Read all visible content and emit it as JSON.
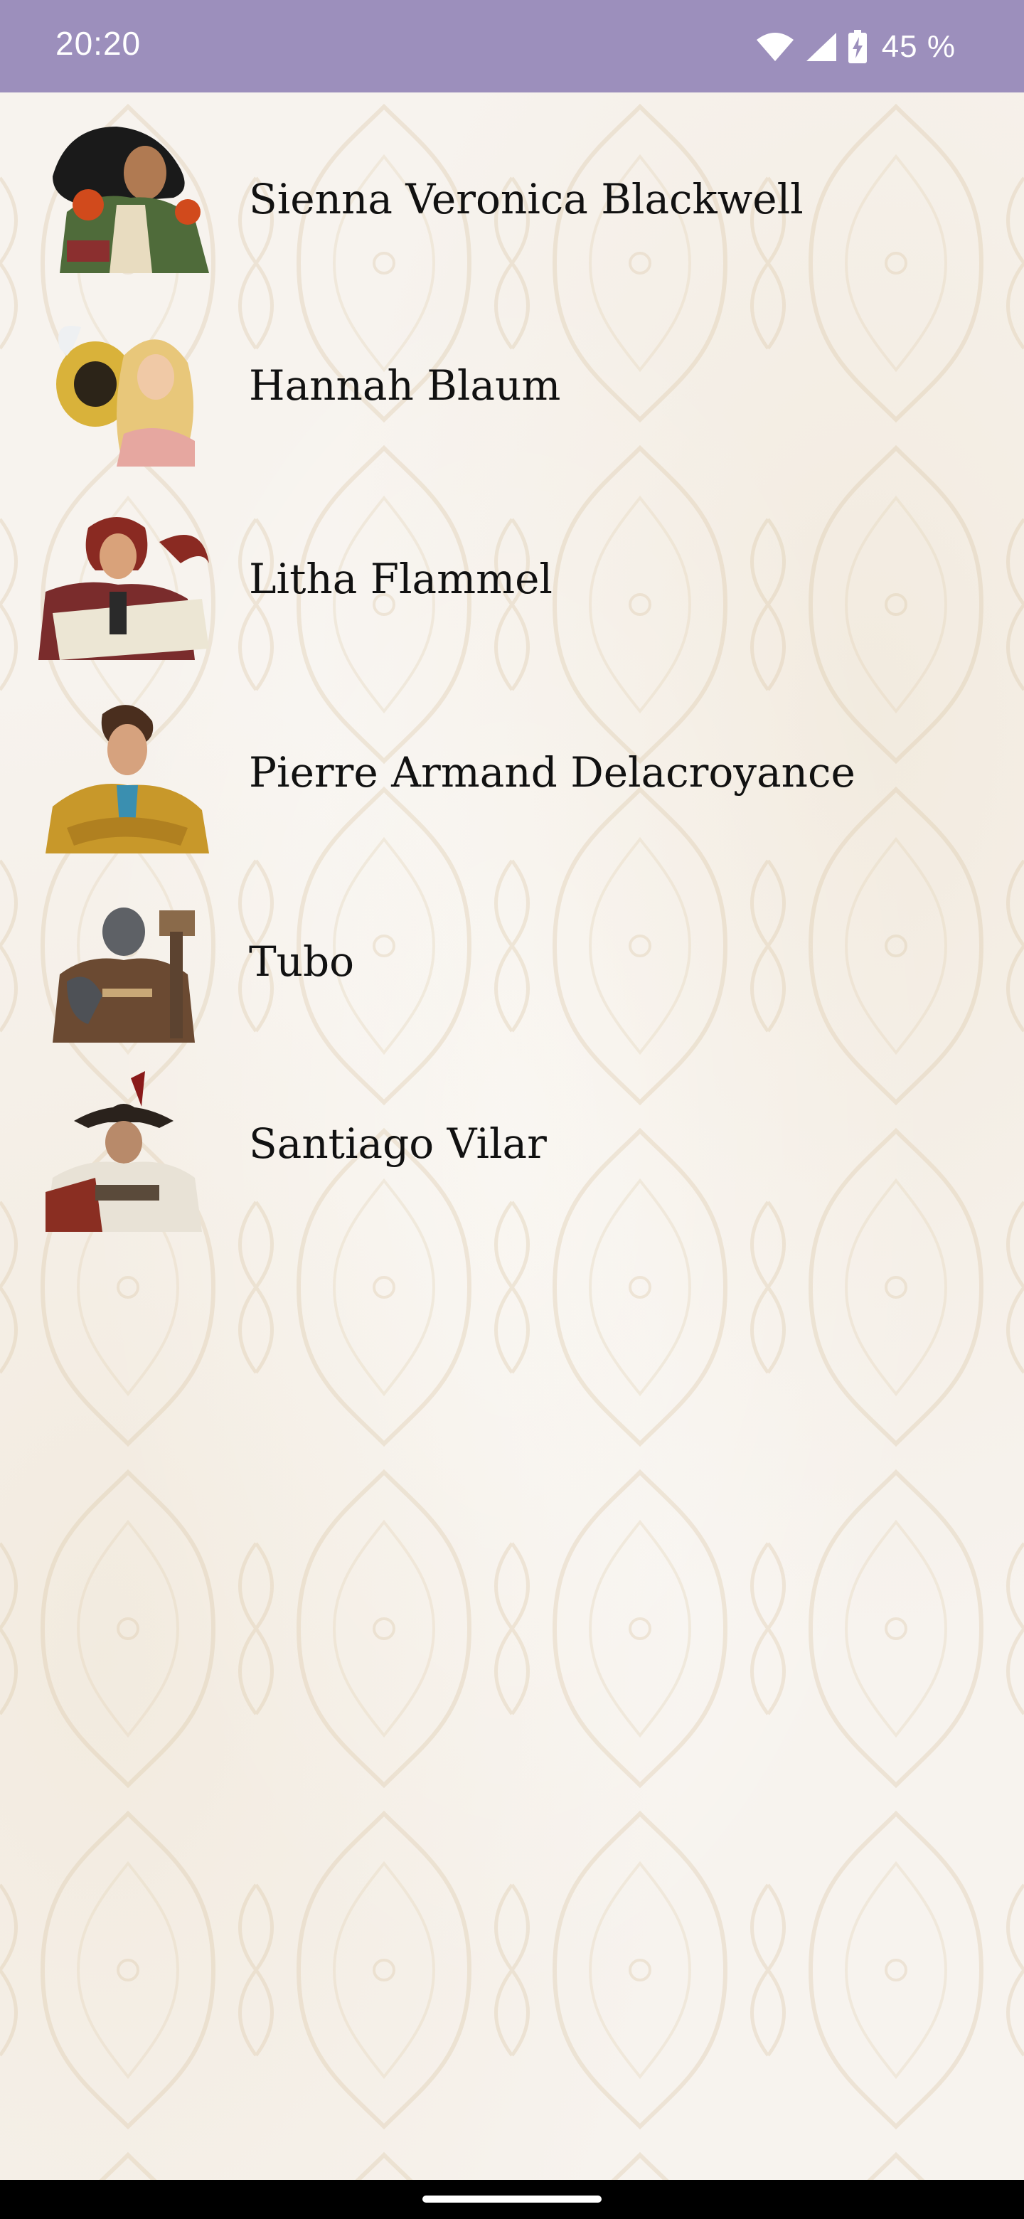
{
  "status_bar": {
    "time": "20:20",
    "battery": "45 %",
    "icons": [
      "wifi-icon",
      "signal-icon",
      "battery-charging-icon"
    ]
  },
  "characters": [
    {
      "name": "Sienna Veronica Blackwell",
      "portrait": "portrait-sienna"
    },
    {
      "name": "Hannah Blaum",
      "portrait": "portrait-hannah"
    },
    {
      "name": "Litha Flammel",
      "portrait": "portrait-litha"
    },
    {
      "name": "Pierre Armand Delacroyance",
      "portrait": "portrait-pierre"
    },
    {
      "name": "Tubo",
      "portrait": "portrait-tubo"
    },
    {
      "name": "Santiago Vilar",
      "portrait": "portrait-santiago"
    }
  ],
  "colors": {
    "status_bar": "#9c8fbc",
    "background": "#f7f3ee",
    "text": "#111111",
    "nav_bar": "#000000"
  }
}
